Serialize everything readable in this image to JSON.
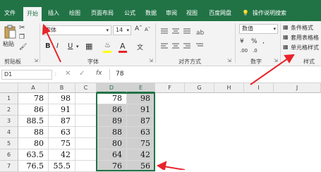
{
  "tabs": [
    "文件",
    "开始",
    "插入",
    "绘图",
    "页面布局",
    "公式",
    "数据",
    "审阅",
    "视图",
    "百度网盘"
  ],
  "tell_me": "操作说明搜索",
  "ribbon": {
    "paste_label": "粘贴",
    "font_name": "宋体",
    "font_size": "14",
    "bold": "B",
    "italic": "I",
    "underline": "U",
    "font_color_glyph": "A",
    "wen_glyph": "文",
    "number_format": "数值",
    "cond_format": "条件格式",
    "table_format": "套用表格格",
    "cell_style": "单元格样式",
    "groups": {
      "clipboard": "剪贴板",
      "font": "字体",
      "alignment": "对齐方式",
      "number": "数字",
      "styles": "样式"
    }
  },
  "formula_bar": {
    "name_box": "D1",
    "fx": "fx",
    "value": "78"
  },
  "columns": [
    "A",
    "B",
    "C",
    "D",
    "E",
    "F",
    "G",
    "H",
    "I",
    "J"
  ],
  "rows": [
    {
      "num": "1",
      "A": "78",
      "B": "98",
      "D": "78",
      "E": "98"
    },
    {
      "num": "2",
      "A": "86",
      "B": "91",
      "D": "86",
      "E": "91"
    },
    {
      "num": "3",
      "A": "88.5",
      "B": "87",
      "D": "89",
      "E": "87"
    },
    {
      "num": "4",
      "A": "88",
      "B": "63",
      "D": "88",
      "E": "63"
    },
    {
      "num": "5",
      "A": "80",
      "B": "75",
      "D": "80",
      "E": "75"
    },
    {
      "num": "6",
      "A": "63.5",
      "B": "42",
      "D": "64",
      "E": "42"
    },
    {
      "num": "7",
      "A": "76.5",
      "B": "55.5",
      "D": "76",
      "E": "56"
    }
  ],
  "colors": {
    "brand": "#217346",
    "annotation_arrow": "#e8242a",
    "selection_fill": "#cfcfcf"
  }
}
